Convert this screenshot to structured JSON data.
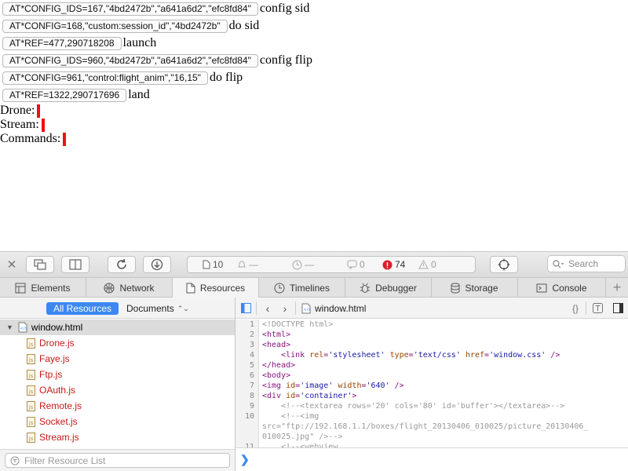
{
  "page": {
    "commands": [
      {
        "value": "AT*CONFIG_IDS=167,\"4bd2472b\",\"a641a6d2\",\"efc8fd84\"",
        "label": "config sid"
      },
      {
        "value": "AT*CONFIG=168,\"custom:session_id\",\"4bd2472b\"",
        "label": "do sid"
      },
      {
        "value": "AT*REF=477,290718208",
        "label": "launch"
      },
      {
        "value": "AT*CONFIG_IDS=960,\"4bd2472b\",\"a641a6d2\",\"efc8fd84\"",
        "label": "config flip"
      },
      {
        "value": "AT*CONFIG=961,\"control:flight_anim\",\"16,15\"",
        "label": "do flip"
      },
      {
        "value": "AT*REF=1322,290717696",
        "label": "land"
      }
    ],
    "status": {
      "drone": "Drone:",
      "stream": "Stream:",
      "commands": "Commands:",
      "indicator_color": "#ee1111"
    }
  },
  "inspector": {
    "toolbar": {
      "resources_count": "10",
      "network_dash": "—",
      "timeline_dash": "—",
      "log_count": "0",
      "error_count": "74",
      "warning_count": "0",
      "error_color": "#d8212b",
      "search_placeholder": "Search"
    },
    "tabs": [
      {
        "label": "Elements",
        "icon": "elements-icon"
      },
      {
        "label": "Network",
        "icon": "network-icon"
      },
      {
        "label": "Resources",
        "icon": "resources-icon",
        "active": true
      },
      {
        "label": "Timelines",
        "icon": "timelines-icon"
      },
      {
        "label": "Debugger",
        "icon": "debugger-icon"
      },
      {
        "label": "Storage",
        "icon": "storage-icon"
      },
      {
        "label": "Console",
        "icon": "console-icon"
      }
    ],
    "sidebar": {
      "scope_all": "All Resources",
      "scope_documents": "Documents",
      "parent": "window.html",
      "items": [
        "Drone.js",
        "Faye.js",
        "Ftp.js",
        "OAuth.js",
        "Remote.js",
        "Socket.js",
        "Stream.js"
      ],
      "filter_placeholder": "Filter Resource List",
      "accent": "#3c87f2"
    },
    "content": {
      "filename": "window.html",
      "code": [
        {
          "n": "1",
          "parts": [
            [
              "c-comment",
              "<!DOCTYPE html>"
            ]
          ]
        },
        {
          "n": "2",
          "parts": [
            [
              "c-tag",
              "<html>"
            ]
          ]
        },
        {
          "n": "3",
          "parts": [
            [
              "c-tag",
              "<head>"
            ]
          ]
        },
        {
          "n": "4",
          "parts": [
            [
              "",
              "    "
            ],
            [
              "c-tag",
              "<link "
            ],
            [
              "c-attr",
              "rel"
            ],
            [
              "c-tag",
              "="
            ],
            [
              "c-str",
              "'stylesheet'"
            ],
            [
              "c-attr",
              " type"
            ],
            [
              "c-tag",
              "="
            ],
            [
              "c-str",
              "'text/css'"
            ],
            [
              "c-attr",
              " href"
            ],
            [
              "c-tag",
              "="
            ],
            [
              "c-str",
              "'window.css'"
            ],
            [
              "c-tag",
              " />"
            ]
          ]
        },
        {
          "n": "5",
          "parts": [
            [
              "c-tag",
              "</head>"
            ]
          ]
        },
        {
          "n": "6",
          "parts": [
            [
              "c-tag",
              "<body>"
            ]
          ]
        },
        {
          "n": "7",
          "parts": [
            [
              "c-tag",
              "<img "
            ],
            [
              "c-attr",
              "id"
            ],
            [
              "c-tag",
              "="
            ],
            [
              "c-str",
              "'image'"
            ],
            [
              "c-attr",
              " width"
            ],
            [
              "c-tag",
              "="
            ],
            [
              "c-str",
              "'640'"
            ],
            [
              "c-tag",
              " />"
            ]
          ]
        },
        {
          "n": "8",
          "parts": [
            [
              "c-tag",
              "<div "
            ],
            [
              "c-attr",
              "id"
            ],
            [
              "c-tag",
              "="
            ],
            [
              "c-str",
              "'container'"
            ],
            [
              "c-tag",
              ">"
            ]
          ]
        },
        {
          "n": "9",
          "parts": [
            [
              "",
              "    "
            ],
            [
              "c-comment",
              "<!--<textarea rows='20' cols='80' id='buffer'></textarea>-->"
            ]
          ]
        },
        {
          "n": "10",
          "parts": [
            [
              "",
              "    "
            ],
            [
              "c-comment",
              "<!--<img"
            ]
          ]
        },
        {
          "n": "",
          "parts": [
            [
              "c-comment",
              "src=\"ftp://192.168.1.1/boxes/flight_20130406_010025/picture_20130406_"
            ]
          ]
        },
        {
          "n": "",
          "parts": [
            [
              "c-comment",
              "010025.jpg\" />-->"
            ]
          ]
        },
        {
          "n": "11",
          "parts": [
            [
              "",
              "    "
            ],
            [
              "c-comment",
              "<!--<webview"
            ]
          ]
        }
      ],
      "prompt_symbol": "❯"
    }
  }
}
